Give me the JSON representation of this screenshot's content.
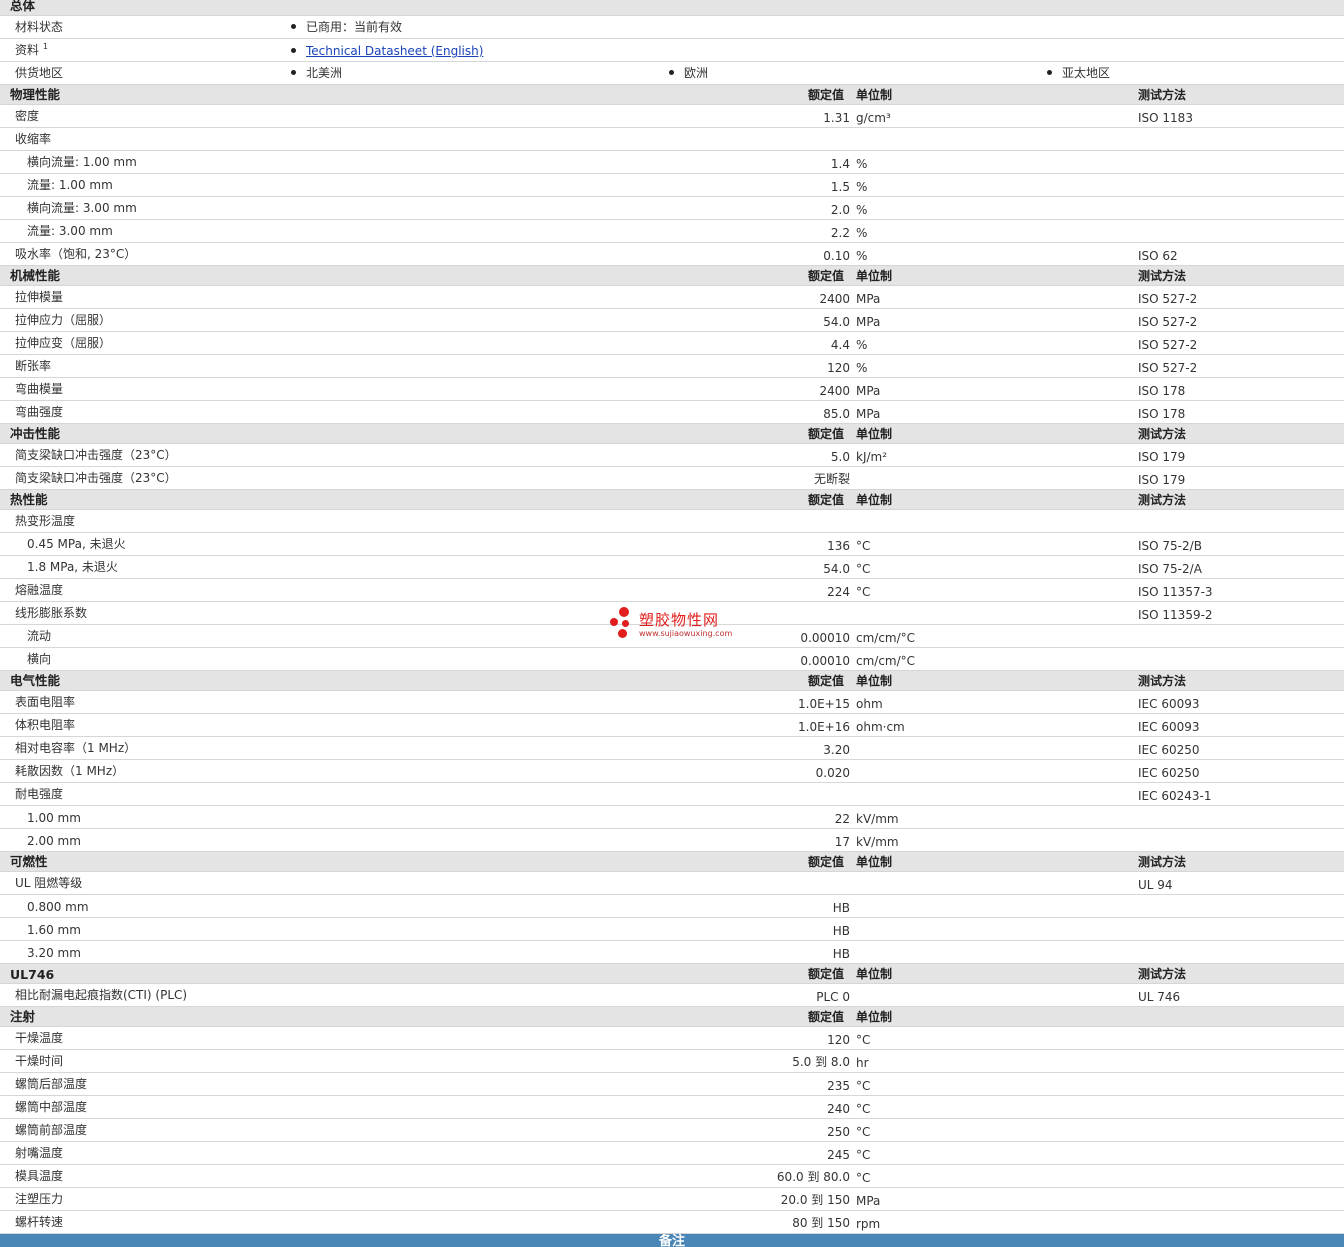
{
  "sheet": {
    "headers": {
      "value": "额定值",
      "unit": "单位制",
      "test": "测试方法"
    },
    "general": {
      "title": "总体",
      "status_label": "材料状态",
      "status_value": "已商用：当前有效",
      "resource_label": "资料",
      "resource_sup": "1",
      "resource_link": "Technical Datasheet (English)",
      "regions_label": "供货地区",
      "regions": [
        "北美洲",
        "欧洲",
        "亚太地区"
      ]
    },
    "sections": [
      {
        "title": "物理性能",
        "headers": true,
        "rows": [
          {
            "label": "密度",
            "value": "1.31",
            "unit": "g/cm³",
            "test": "ISO 1183"
          },
          {
            "label": "收缩率",
            "value": "",
            "unit": "",
            "test": ""
          },
          {
            "label": "横向流量: 1.00 mm",
            "value": "1.4",
            "unit": "%",
            "test": "",
            "sub": true
          },
          {
            "label": "流量: 1.00 mm",
            "value": "1.5",
            "unit": "%",
            "test": "",
            "sub": true
          },
          {
            "label": "横向流量: 3.00 mm",
            "value": "2.0",
            "unit": "%",
            "test": "",
            "sub": true
          },
          {
            "label": "流量: 3.00 mm",
            "value": "2.2",
            "unit": "%",
            "test": "",
            "sub": true
          },
          {
            "label": "吸水率（饱和, 23°C）",
            "value": "0.10",
            "unit": "%",
            "test": "ISO 62"
          }
        ]
      },
      {
        "title": "机械性能",
        "headers": true,
        "rows": [
          {
            "label": "拉伸模量",
            "value": "2400",
            "unit": "MPa",
            "test": "ISO 527-2"
          },
          {
            "label": "拉伸应力（屈服）",
            "value": "54.0",
            "unit": "MPa",
            "test": "ISO 527-2"
          },
          {
            "label": "拉伸应变（屈服）",
            "value": "4.4",
            "unit": "%",
            "test": "ISO 527-2"
          },
          {
            "label": "断张率",
            "value": "120",
            "unit": "%",
            "test": "ISO 527-2"
          },
          {
            "label": "弯曲模量",
            "value": "2400",
            "unit": "MPa",
            "test": "ISO 178"
          },
          {
            "label": "弯曲强度",
            "value": "85.0",
            "unit": "MPa",
            "test": "ISO 178"
          }
        ]
      },
      {
        "title": "冲击性能",
        "headers": true,
        "rows": [
          {
            "label": "简支梁缺口冲击强度（23°C）",
            "value": "5.0",
            "unit": "kJ/m²",
            "test": "ISO 179"
          },
          {
            "label": "简支梁缺口冲击强度（23°C）",
            "value": "无断裂",
            "unit": "",
            "test": "ISO 179"
          }
        ]
      },
      {
        "title": "热性能",
        "headers": true,
        "rows": [
          {
            "label": "热变形温度",
            "value": "",
            "unit": "",
            "test": ""
          },
          {
            "label": "0.45 MPa, 未退火",
            "value": "136",
            "unit": "°C",
            "test": "ISO 75-2/B",
            "sub": true
          },
          {
            "label": "1.8 MPa, 未退火",
            "value": "54.0",
            "unit": "°C",
            "test": "ISO 75-2/A",
            "sub": true
          },
          {
            "label": "熔融温度",
            "value": "224",
            "unit": "°C",
            "test": "ISO 11357-3"
          },
          {
            "label": "线形膨胀系数",
            "value": "",
            "unit": "",
            "test": "ISO 11359-2"
          },
          {
            "label": "流动",
            "value": "0.00010",
            "unit": "cm/cm/°C",
            "test": "",
            "sub": true
          },
          {
            "label": "横向",
            "value": "0.00010",
            "unit": "cm/cm/°C",
            "test": "",
            "sub": true
          }
        ]
      },
      {
        "title": "电气性能",
        "headers": true,
        "rows": [
          {
            "label": "表面电阻率",
            "value": "1.0E+15",
            "unit": "ohm",
            "test": "IEC 60093"
          },
          {
            "label": "体积电阻率",
            "value": "1.0E+16",
            "unit": "ohm·cm",
            "test": "IEC 60093"
          },
          {
            "label": "相对电容率（1 MHz）",
            "value": "3.20",
            "unit": "",
            "test": "IEC 60250"
          },
          {
            "label": "耗散因数（1 MHz）",
            "value": "0.020",
            "unit": "",
            "test": "IEC 60250"
          },
          {
            "label": "耐电强度",
            "value": "",
            "unit": "",
            "test": "IEC 60243-1"
          },
          {
            "label": "1.00 mm",
            "value": "22",
            "unit": "kV/mm",
            "test": "",
            "sub": true
          },
          {
            "label": "2.00 mm",
            "value": "17",
            "unit": "kV/mm",
            "test": "",
            "sub": true
          }
        ]
      },
      {
        "title": "可燃性",
        "headers": true,
        "rows": [
          {
            "label": "UL 阻燃等级",
            "value": "",
            "unit": "",
            "test": "UL 94"
          },
          {
            "label": "0.800 mm",
            "value": "HB",
            "unit": "",
            "test": "",
            "sub": true
          },
          {
            "label": "1.60 mm",
            "value": "HB",
            "unit": "",
            "test": "",
            "sub": true
          },
          {
            "label": "3.20 mm",
            "value": "HB",
            "unit": "",
            "test": "",
            "sub": true
          }
        ]
      },
      {
        "title": "UL746",
        "headers": true,
        "rows": [
          {
            "label": "相比耐漏电起痕指数(CTI) (PLC)",
            "value": "PLC 0",
            "unit": "",
            "test": "UL 746"
          }
        ]
      },
      {
        "title": "注射",
        "headers": true,
        "no_test": true,
        "rows": [
          {
            "label": "干燥温度",
            "value": "120",
            "unit": "°C",
            "test": ""
          },
          {
            "label": "干燥时间",
            "value": "5.0 到  8.0",
            "unit": "hr",
            "test": ""
          },
          {
            "label": "螺筒后部温度",
            "value": "235",
            "unit": "°C",
            "test": ""
          },
          {
            "label": "螺筒中部温度",
            "value": "240",
            "unit": "°C",
            "test": ""
          },
          {
            "label": "螺筒前部温度",
            "value": "250",
            "unit": "°C",
            "test": ""
          },
          {
            "label": "射嘴温度",
            "value": "245",
            "unit": "°C",
            "test": ""
          },
          {
            "label": "模具温度",
            "value": "60.0 到  80.0",
            "unit": "°C",
            "test": ""
          },
          {
            "label": "注塑压力",
            "value": "20.0 到  150",
            "unit": "MPa",
            "test": ""
          },
          {
            "label": "螺杆转速",
            "value": "80 到  150",
            "unit": "rpm",
            "test": ""
          }
        ]
      }
    ],
    "notes_title": "备注"
  },
  "watermark": {
    "title": "塑胶物性网",
    "url": "www.sujiaowuxing.com",
    "color": "#e21d1d"
  }
}
